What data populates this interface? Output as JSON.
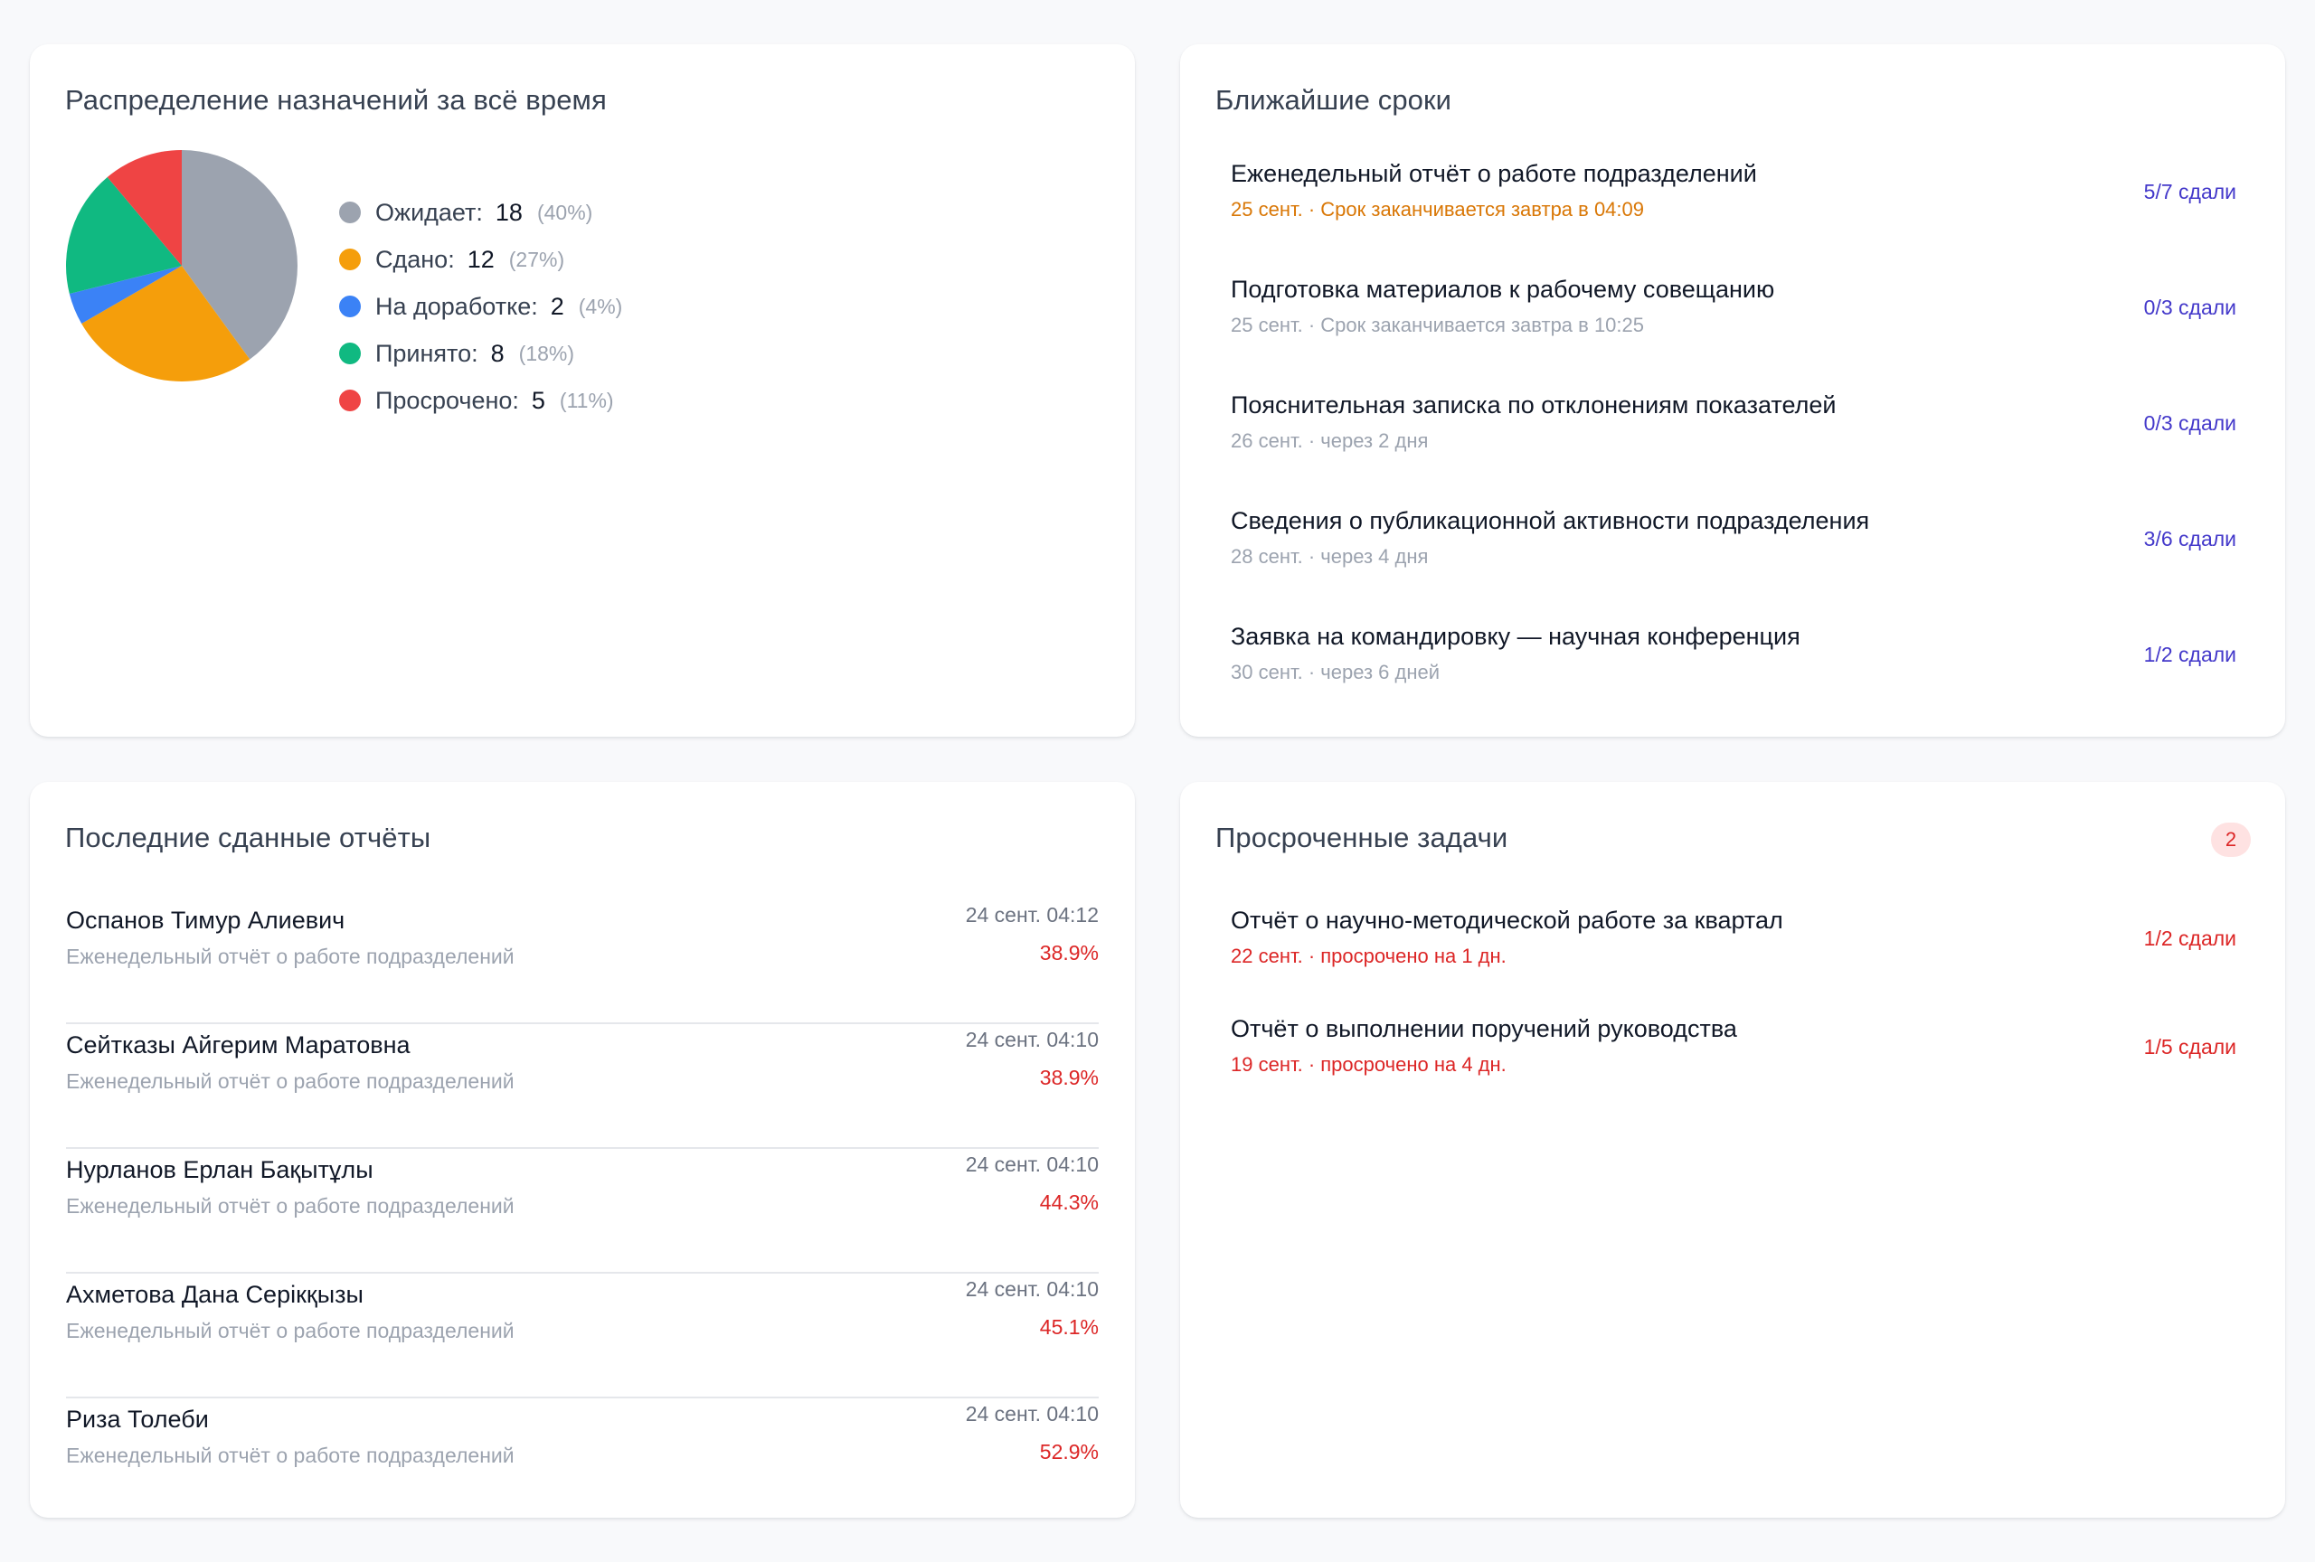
{
  "distribution": {
    "title": "Распределение назначений за всё время",
    "items": [
      {
        "label": "Ожидает:",
        "count": "18",
        "pct": "(40%)",
        "value": 18,
        "color": "#9ca3af"
      },
      {
        "label": "Сдано:",
        "count": "12",
        "pct": "(27%)",
        "value": 12,
        "color": "#f59e0b"
      },
      {
        "label": "На доработке:",
        "count": "2",
        "pct": "(4%)",
        "value": 2,
        "color": "#3b82f6"
      },
      {
        "label": "Принято:",
        "count": "8",
        "pct": "(18%)",
        "value": 8,
        "color": "#10b981"
      },
      {
        "label": "Просрочено:",
        "count": "5",
        "pct": "(11%)",
        "value": 5,
        "color": "#ef4444"
      }
    ]
  },
  "chart_data": {
    "type": "pie",
    "categories": [
      "Ожидает",
      "Сдано",
      "На доработке",
      "Принято",
      "Просрочено"
    ],
    "values": [
      18,
      12,
      2,
      8,
      5
    ],
    "colors": [
      "#9ca3af",
      "#f59e0b",
      "#3b82f6",
      "#10b981",
      "#ef4444"
    ]
  },
  "deadlines": {
    "title": "Ближайшие сроки",
    "items": [
      {
        "title": "Еженедельный отчёт о работе подразделений",
        "sub": "25 сент. · Срок заканчивается завтра в 04:09",
        "count": "5/7 сдали",
        "tone": "soon"
      },
      {
        "title": "Подготовка материалов к рабочему совещанию",
        "sub": "25 сент. · Срок заканчивается завтра в 10:25",
        "count": "0/3 сдали",
        "tone": "normal"
      },
      {
        "title": "Пояснительная записка по отклонениям показателей",
        "sub": "26 сент. · через 2 дня",
        "count": "0/3 сдали",
        "tone": "normal"
      },
      {
        "title": "Сведения о публикационной активности подразделения",
        "sub": "28 сент. · через 4 дня",
        "count": "3/6 сдали",
        "tone": "normal"
      },
      {
        "title": "Заявка на командировку — научная конференция",
        "sub": "30 сент. · через 6 дней",
        "count": "1/2 сдали",
        "tone": "normal"
      }
    ]
  },
  "recent": {
    "title": "Последние сданные отчёты",
    "items": [
      {
        "name": "Оспанов Тимур Алиевич",
        "task": "Еженедельный отчёт о работе подразделений",
        "date": "24 сент. 04:12",
        "score": "38.9%"
      },
      {
        "name": "Сейтказы Айгерим Маратовна",
        "task": "Еженедельный отчёт о работе подразделений",
        "date": "24 сент. 04:10",
        "score": "38.9%"
      },
      {
        "name": "Нурланов Ерлан Бақытұлы",
        "task": "Еженедельный отчёт о работе подразделений",
        "date": "24 сент. 04:10",
        "score": "44.3%"
      },
      {
        "name": "Ахметова Дана Серікқызы",
        "task": "Еженедельный отчёт о работе подразделений",
        "date": "24 сент. 04:10",
        "score": "45.1%"
      },
      {
        "name": "Риза Толеби",
        "task": "Еженедельный отчёт о работе подразделений",
        "date": "24 сент. 04:10",
        "score": "52.9%"
      }
    ]
  },
  "overdue": {
    "title": "Просроченные задачи",
    "badge": "2",
    "items": [
      {
        "title": "Отчёт о научно-методической работе за квартал",
        "sub": "22 сент. · просрочено на 1 дн.",
        "count": "1/2 сдали"
      },
      {
        "title": "Отчёт о выполнении поручений руководства",
        "sub": "19 сент. · просрочено на 4 дн.",
        "count": "1/5 сдали"
      }
    ]
  }
}
